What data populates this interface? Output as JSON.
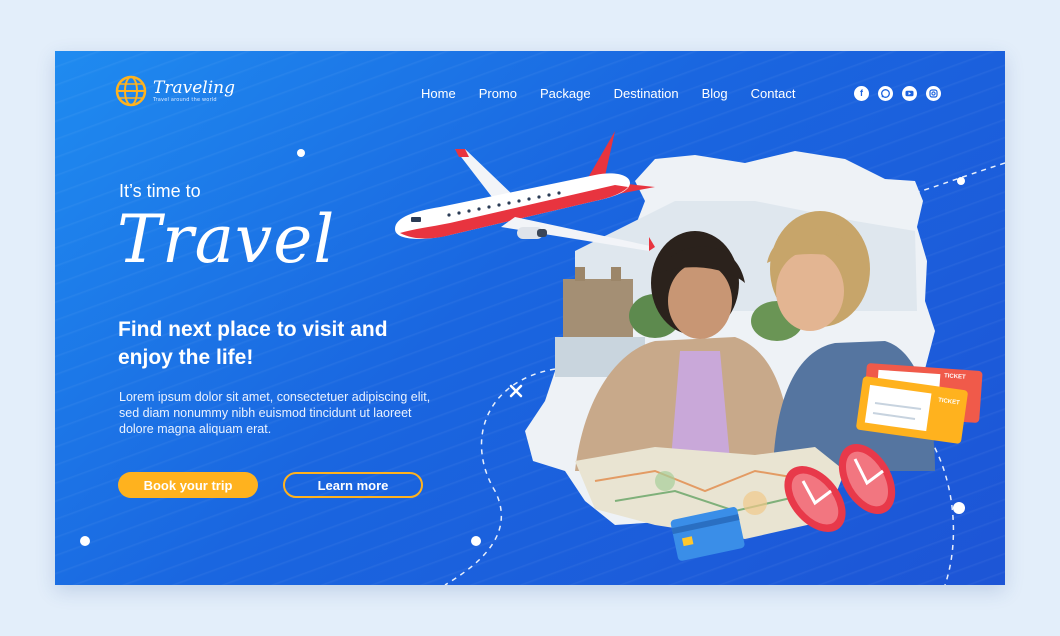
{
  "brand": {
    "name": "Traveling",
    "tagline": "Travel around the world"
  },
  "nav": {
    "items": [
      "Home",
      "Promo",
      "Package",
      "Destination",
      "Blog",
      "Contact"
    ]
  },
  "social": [
    "facebook-icon",
    "whatsapp-icon",
    "youtube-icon",
    "instagram-icon"
  ],
  "hero": {
    "pre_title": "It’s time to",
    "title": "Travel",
    "headline": "Find next place to visit and enjoy the life!",
    "body": "Lorem ipsum dolor sit amet, consectetuer adipiscing elit, sed diam nonummy nibh euismod tincidunt ut laoreet dolore magna aliquam erat.",
    "book_label": "Book your trip",
    "learn_label": "Learn more"
  },
  "tickets": {
    "label": "TICKET"
  },
  "colors": {
    "accent": "#ffb21e",
    "bg_top": "#1f8bf0",
    "bg_bottom": "#1d55d6",
    "plane_red": "#e8343f"
  }
}
